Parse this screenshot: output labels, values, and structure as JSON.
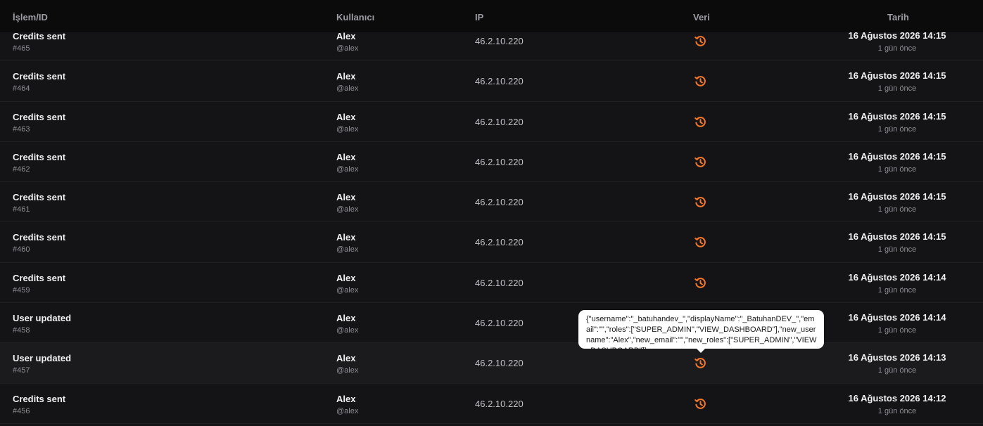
{
  "header": {
    "col_action": "İşlem/ID",
    "col_user": "Kullanıcı",
    "col_ip": "IP",
    "col_data": "Veri",
    "col_date": "Tarih"
  },
  "rows": [
    {
      "action": "Credits sent",
      "id": "#465",
      "user": "Alex",
      "handle": "@alex",
      "ip": "46.2.10.220",
      "date": "16 Ağustos 2026 14:15",
      "relative": "1 gün önce"
    },
    {
      "action": "Credits sent",
      "id": "#464",
      "user": "Alex",
      "handle": "@alex",
      "ip": "46.2.10.220",
      "date": "16 Ağustos 2026 14:15",
      "relative": "1 gün önce"
    },
    {
      "action": "Credits sent",
      "id": "#463",
      "user": "Alex",
      "handle": "@alex",
      "ip": "46.2.10.220",
      "date": "16 Ağustos 2026 14:15",
      "relative": "1 gün önce"
    },
    {
      "action": "Credits sent",
      "id": "#462",
      "user": "Alex",
      "handle": "@alex",
      "ip": "46.2.10.220",
      "date": "16 Ağustos 2026 14:15",
      "relative": "1 gün önce"
    },
    {
      "action": "Credits sent",
      "id": "#461",
      "user": "Alex",
      "handle": "@alex",
      "ip": "46.2.10.220",
      "date": "16 Ağustos 2026 14:15",
      "relative": "1 gün önce"
    },
    {
      "action": "Credits sent",
      "id": "#460",
      "user": "Alex",
      "handle": "@alex",
      "ip": "46.2.10.220",
      "date": "16 Ağustos 2026 14:15",
      "relative": "1 gün önce"
    },
    {
      "action": "Credits sent",
      "id": "#459",
      "user": "Alex",
      "handle": "@alex",
      "ip": "46.2.10.220",
      "date": "16 Ağustos 2026 14:14",
      "relative": "1 gün önce"
    },
    {
      "action": "User updated",
      "id": "#458",
      "user": "Alex",
      "handle": "@alex",
      "ip": "46.2.10.220",
      "date": "16 Ağustos 2026 14:14",
      "relative": "1 gün önce"
    },
    {
      "action": "User updated",
      "id": "#457",
      "user": "Alex",
      "handle": "@alex",
      "ip": "46.2.10.220",
      "date": "16 Ağustos 2026 14:13",
      "relative": "1 gün önce"
    },
    {
      "action": "Credits sent",
      "id": "#456",
      "user": "Alex",
      "handle": "@alex",
      "ip": "46.2.10.220",
      "date": "16 Ağustos 2026 14:12",
      "relative": "1 gün önce"
    }
  ],
  "tooltip": {
    "text": "{\"username\":\"_batuhandev_\",\"displayName\":\"_BatuhanDEV_\",\"email\":\"\",\"roles\":[\"SUPER_ADMIN\",\"VIEW_DASHBOARD\"],\"new_username\":\"Alex\",\"new_email\":\"\",\"new_roles\":[\"SUPER_ADMIN\",\"VIEW_DASHBOARD\"]}"
  },
  "icons": {
    "data_icon": "history-icon"
  },
  "colors": {
    "accent": "#f4772a",
    "background": "#141416",
    "header_bg": "#0b0b0c",
    "row_alt_bg": "#1b1b1e"
  }
}
